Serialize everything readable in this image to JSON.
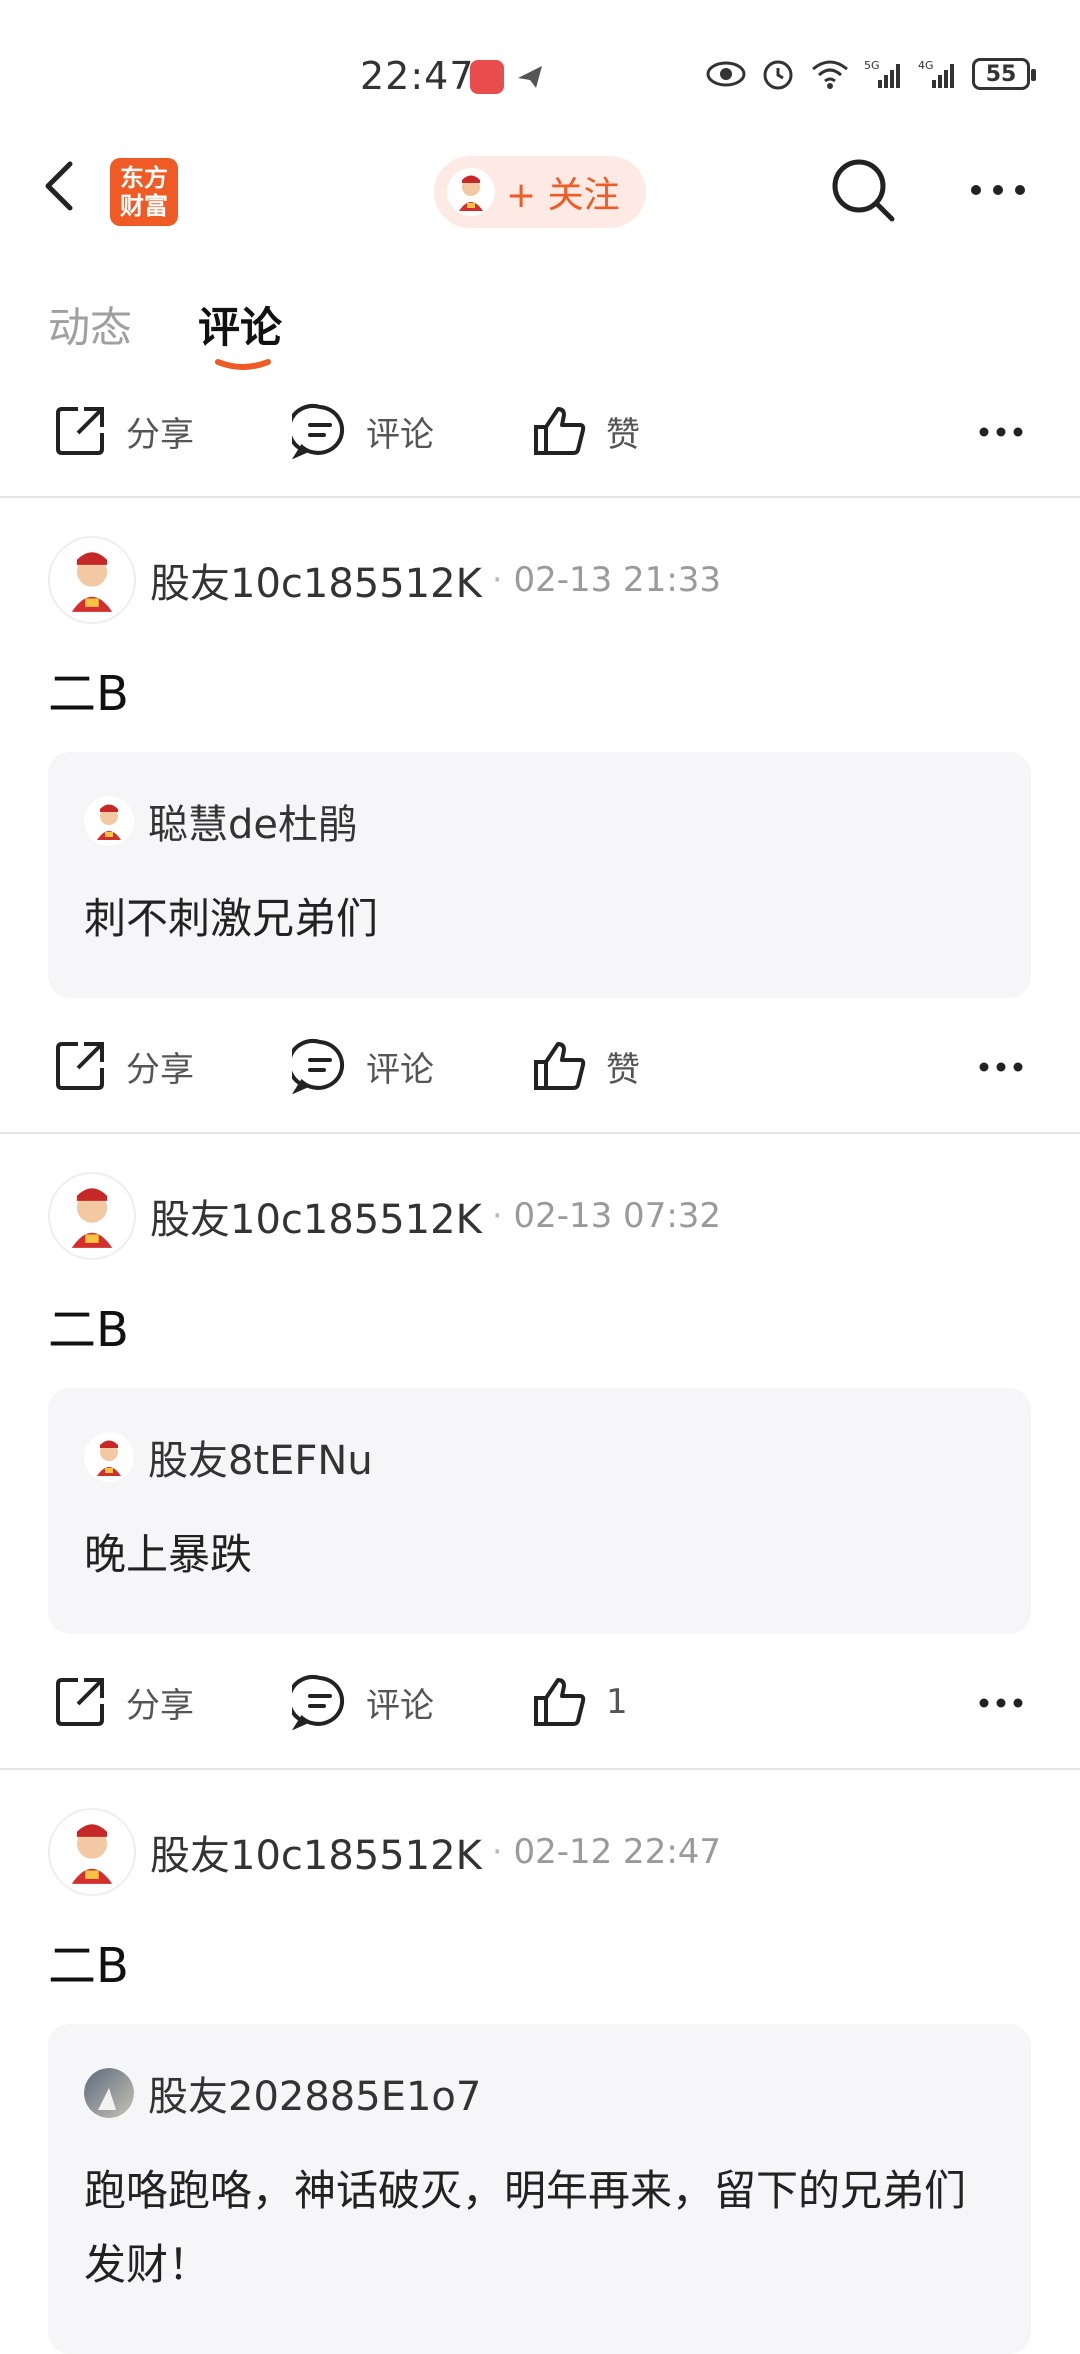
{
  "status_bar": {
    "time": "22:47",
    "battery": "55"
  },
  "header": {
    "brand_logo_line1": "东方",
    "brand_logo_line2": "财富",
    "follow_label": "+ 关注"
  },
  "tabs": [
    {
      "label": "动态"
    },
    {
      "label": "评论"
    }
  ],
  "actions": {
    "share": "分享",
    "comment": "评论",
    "like": "赞"
  },
  "posts": [
    {
      "user": "股友10c185512K",
      "time": "02-13 21:33",
      "text": "二B",
      "quote_user": "聪慧de杜鹃",
      "quote_text": "刺不刺激兄弟们",
      "like_label": "赞"
    },
    {
      "user": "股友10c185512K",
      "time": "02-13 07:32",
      "text": "二B",
      "quote_user": "股友8tEFNu",
      "quote_text": "晚上暴跌",
      "like_label": "1"
    },
    {
      "user": "股友10c185512K",
      "time": "02-12 22:47",
      "text": "二B",
      "quote_user": "股友202885E1o7",
      "quote_text": "跑咯跑咯，神话破灭，明年再来，留下的兄弟们发财！"
    }
  ],
  "colors": {
    "accent": "#f05a24",
    "follow_bg": "#fdeae4",
    "quote_bg": "#f6f6f8"
  }
}
